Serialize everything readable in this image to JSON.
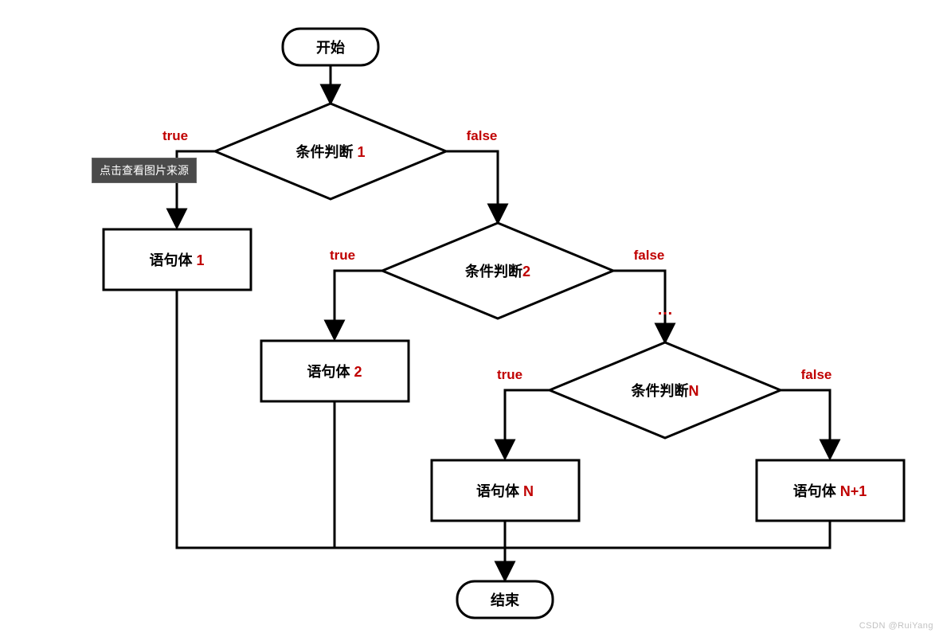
{
  "flow": {
    "start": "开始",
    "end": "结束",
    "decisions": {
      "d1": {
        "prefix": "条件判断 ",
        "num": "1"
      },
      "d2": {
        "prefix": "条件判断",
        "num": "2"
      },
      "dN": {
        "prefix": "条件判断",
        "num": "N"
      }
    },
    "bodies": {
      "b1": {
        "prefix": "语句体 ",
        "num": "1"
      },
      "b2": {
        "prefix": "语句体 ",
        "num": "2"
      },
      "bN": {
        "prefix": "语句体 ",
        "num": "N"
      },
      "bN1": {
        "prefix": "语句体 ",
        "num": "N+1"
      }
    },
    "labels": {
      "true": "true",
      "false": "false",
      "ellipsis": "…"
    }
  },
  "tooltip": "点击查看图片来源",
  "watermark": "CSDN @RuiYang"
}
